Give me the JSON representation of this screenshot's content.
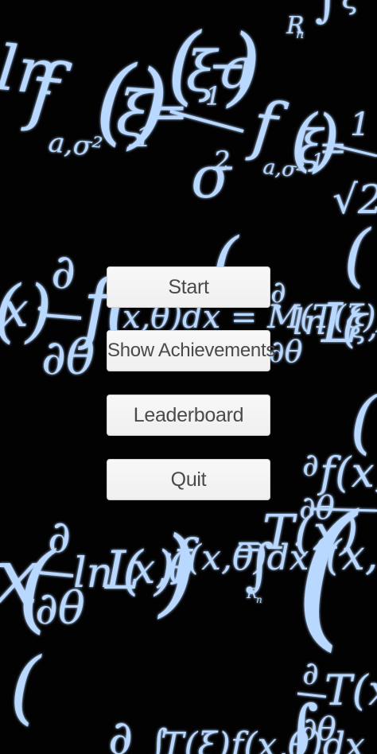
{
  "menu": {
    "start_label": "Start",
    "achievements_label": "Show Achievements",
    "leaderboard_label": "Leaderboard",
    "quit_label": "Quit"
  },
  "background": {
    "description_icon": "math-formula-background",
    "formula_color": "#b8d8ff"
  }
}
